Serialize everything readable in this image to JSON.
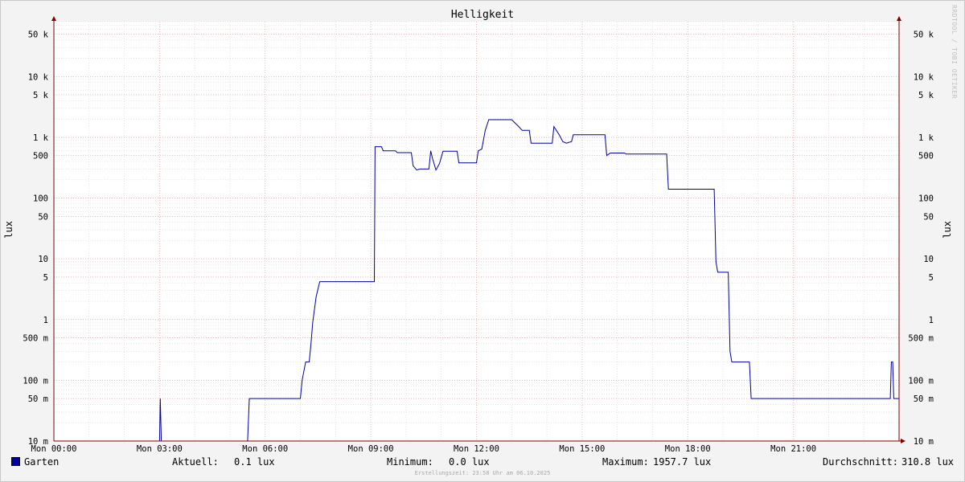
{
  "chart_data": {
    "type": "line",
    "title": "Helligkeit",
    "ylabel": "lux",
    "yscale": "log",
    "ylim": [
      0.01,
      80000
    ],
    "y_ticks": [
      {
        "value": 0.01,
        "label": "10 m"
      },
      {
        "value": 0.05,
        "label": "50 m"
      },
      {
        "value": 0.1,
        "label": "100 m"
      },
      {
        "value": 0.5,
        "label": "500 m"
      },
      {
        "value": 1,
        "label": "1"
      },
      {
        "value": 5,
        "label": "5"
      },
      {
        "value": 10,
        "label": "10"
      },
      {
        "value": 50,
        "label": "50"
      },
      {
        "value": 100,
        "label": "100"
      },
      {
        "value": 500,
        "label": "500"
      },
      {
        "value": 1000,
        "label": "1 k"
      },
      {
        "value": 5000,
        "label": "5 k"
      },
      {
        "value": 10000,
        "label": "10 k"
      },
      {
        "value": 50000,
        "label": "50 k"
      }
    ],
    "x_unit": "hours since Mon 00:00",
    "xlim": [
      0,
      24
    ],
    "x_ticks": [
      {
        "value": 0,
        "label": "Mon 00:00"
      },
      {
        "value": 3,
        "label": "Mon 03:00"
      },
      {
        "value": 6,
        "label": "Mon 06:00"
      },
      {
        "value": 9,
        "label": "Mon 09:00"
      },
      {
        "value": 12,
        "label": "Mon 12:00"
      },
      {
        "value": 15,
        "label": "Mon 15:00"
      },
      {
        "value": 18,
        "label": "Mon 18:00"
      },
      {
        "value": 21,
        "label": "Mon 21:00"
      }
    ],
    "grid": true,
    "legend_position": "bottom-left",
    "colors": {
      "series": "#0000a0",
      "major_grid": "#e8a0a0",
      "minor_grid": "#d0d0d0",
      "axis": "#800000",
      "plot_bg": "#ffffff"
    },
    "series": [
      {
        "name": "Garten",
        "points": [
          [
            0,
            0.01
          ],
          [
            3.0,
            0.01
          ],
          [
            3.02,
            0.05
          ],
          [
            3.05,
            0.01
          ],
          [
            5.5,
            0.01
          ],
          [
            5.55,
            0.05
          ],
          [
            7.0,
            0.05
          ],
          [
            7.05,
            0.1
          ],
          [
            7.15,
            0.2
          ],
          [
            7.25,
            0.2
          ],
          [
            7.3,
            0.4
          ],
          [
            7.35,
            0.9
          ],
          [
            7.45,
            2.4
          ],
          [
            7.55,
            4.2
          ],
          [
            9.1,
            4.2
          ],
          [
            9.12,
            700
          ],
          [
            9.3,
            700
          ],
          [
            9.35,
            600
          ],
          [
            9.7,
            600
          ],
          [
            9.75,
            560
          ],
          [
            10.15,
            560
          ],
          [
            10.2,
            340
          ],
          [
            10.3,
            290
          ],
          [
            10.4,
            300
          ],
          [
            10.65,
            300
          ],
          [
            10.7,
            600
          ],
          [
            10.75,
            450
          ],
          [
            10.85,
            290
          ],
          [
            10.95,
            370
          ],
          [
            11.05,
            590
          ],
          [
            11.45,
            590
          ],
          [
            11.5,
            380
          ],
          [
            12.0,
            380
          ],
          [
            12.05,
            600
          ],
          [
            12.15,
            640
          ],
          [
            12.25,
            1300
          ],
          [
            12.35,
            1950
          ],
          [
            13.0,
            1950
          ],
          [
            13.2,
            1500
          ],
          [
            13.3,
            1300
          ],
          [
            13.5,
            1300
          ],
          [
            13.55,
            800
          ],
          [
            14.15,
            800
          ],
          [
            14.2,
            1500
          ],
          [
            14.35,
            1100
          ],
          [
            14.45,
            850
          ],
          [
            14.55,
            800
          ],
          [
            14.7,
            850
          ],
          [
            14.75,
            1100
          ],
          [
            15.65,
            1100
          ],
          [
            15.7,
            500
          ],
          [
            15.8,
            550
          ],
          [
            16.2,
            550
          ],
          [
            16.25,
            530
          ],
          [
            17.4,
            530
          ],
          [
            17.45,
            140
          ],
          [
            18.75,
            140
          ],
          [
            18.8,
            9
          ],
          [
            18.85,
            6
          ],
          [
            19.15,
            6
          ],
          [
            19.2,
            0.3
          ],
          [
            19.25,
            0.2
          ],
          [
            19.75,
            0.2
          ],
          [
            19.8,
            0.05
          ],
          [
            23.75,
            0.05
          ],
          [
            23.78,
            0.2
          ],
          [
            23.82,
            0.2
          ],
          [
            23.85,
            0.05
          ],
          [
            24,
            0.05
          ]
        ]
      }
    ],
    "legend": {
      "series_name": "Garten",
      "current_label": "Aktuell:",
      "current_value": "0.1 lux",
      "min_label": "Minimum:",
      "min_value": "0.0 lux",
      "max_label": "Maximum:",
      "max_value": "1957.7 lux",
      "avg_label": "Durchschnitt:",
      "avg_value": "310.8 lux"
    }
  },
  "watermark": "RRDTOOL / TOBI OETIKER",
  "footer": "Erstellungszeit: 23:58 Uhr am 06.10.2025"
}
